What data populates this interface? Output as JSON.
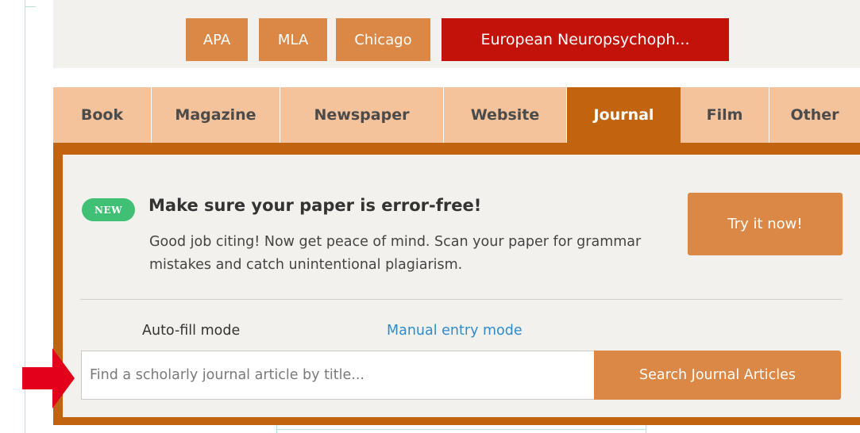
{
  "citation_styles": {
    "apa": "APA",
    "mla": "MLA",
    "chicago": "Chicago",
    "selected": "European Neuropsychoph..."
  },
  "source_tabs": [
    {
      "label": "Book"
    },
    {
      "label": "Magazine"
    },
    {
      "label": "Newspaper"
    },
    {
      "label": "Website"
    },
    {
      "label": "Journal",
      "active": true
    },
    {
      "label": "Film"
    },
    {
      "label": "Other"
    }
  ],
  "promo": {
    "badge": "NEW",
    "title": "Make sure your paper is error-free!",
    "body": "Good job citing! Now get peace of mind. Scan your paper for grammar mistakes and catch unintentional plagiarism.",
    "button": "Try it now!"
  },
  "modes": {
    "auto": "Auto-fill mode",
    "manual": "Manual entry mode"
  },
  "search": {
    "placeholder": "Find a scholarly journal article by title...",
    "value": "",
    "button": "Search Journal Articles"
  },
  "colors": {
    "accent_orange": "#db8745",
    "tab_active": "#c2630f",
    "tab_bg": "#f4c39b",
    "selected_style": "#c3120a",
    "new_badge": "#3fc074",
    "link": "#2f8ccc",
    "annotation_arrow": "#e3001b"
  },
  "annotation": {
    "icon": "red-arrow-icon"
  }
}
